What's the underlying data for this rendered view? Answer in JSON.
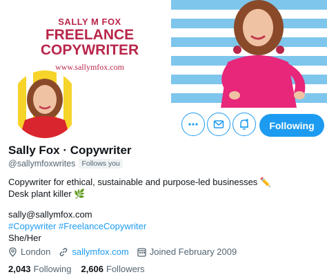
{
  "banner": {
    "name": "SALLY M FOX",
    "title_line1": "FREELANCE",
    "title_line2": "COPYWRITER",
    "url": "www.sallymfox.com"
  },
  "actions": {
    "follow_label": "Following"
  },
  "profile": {
    "display_name": "Sally Fox · Copywriter",
    "handle": "@sallymfoxwrites",
    "follows_you": "Follows you",
    "bio_line1": "Copywriter for ethical, sustainable and purpose-led businesses ✏️",
    "bio_line2": "Desk plant killer 🌿",
    "email": "sally@sallymfox.com",
    "hashtag1": "#Copywriter",
    "hashtag2": "#FreelanceCopywriter",
    "pronouns": "She/Her"
  },
  "meta": {
    "location": "London",
    "website": "sallymfox.com",
    "joined": "Joined February 2009"
  },
  "stats": {
    "following_count": "2,043",
    "following_label": "Following",
    "followers_count": "2,606",
    "followers_label": "Followers"
  },
  "colors": {
    "accent": "#1d9bf0",
    "brand": "#b8264a",
    "secondary_text": "#536471"
  }
}
